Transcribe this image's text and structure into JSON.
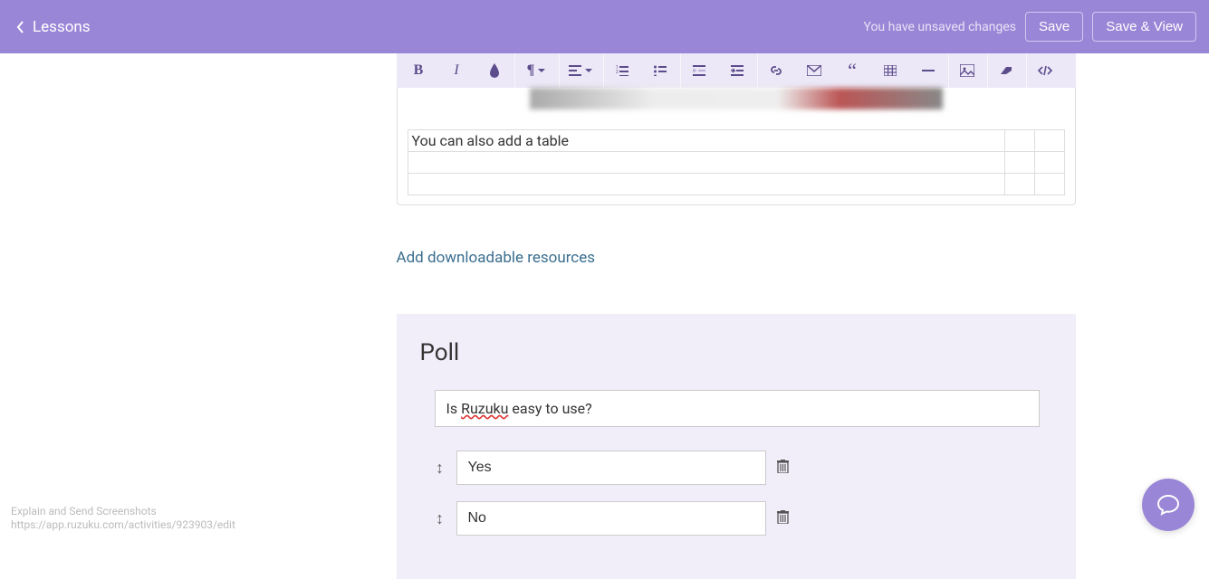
{
  "header": {
    "back_label": "Lessons",
    "unsaved_text": "You have unsaved changes",
    "save_label": "Save",
    "save_view_label": "Save & View"
  },
  "editor": {
    "table_cell_0_0": "You can also add a table"
  },
  "downloads": {
    "add_link": "Add downloadable resources"
  },
  "poll": {
    "title": "Poll",
    "question_prefix": "Is ",
    "question_underlined": "Ruzuku",
    "question_suffix": " easy to use?",
    "options": [
      "Yes",
      "No"
    ]
  },
  "footer": {
    "line1": "Explain and Send Screenshots",
    "line2": "https://app.ruzuku.com/activities/923903/edit"
  }
}
